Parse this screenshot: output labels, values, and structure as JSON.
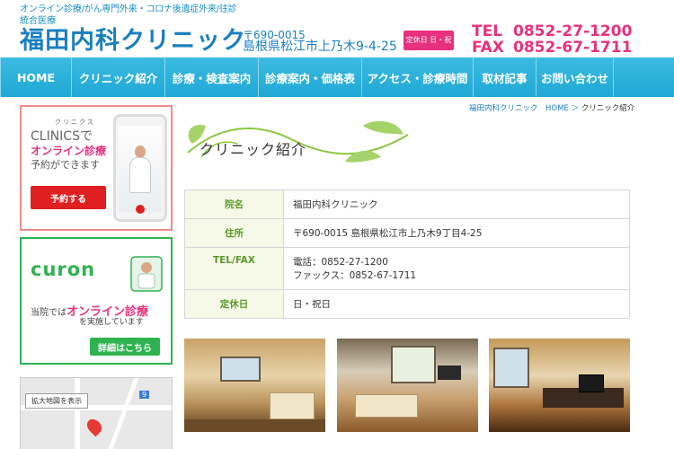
{
  "header": {
    "tagline": "オンライン診療/がん専門外来・コロナ後遺症外来/往診",
    "sub_tag": "統合医療",
    "clinic_name": "福田内科クリニック",
    "postal": "〒690-0015",
    "address": "島根県松江市上乃木9-4-25",
    "holiday_badge": "定休日 日・祝日",
    "tel_label": "TEL",
    "tel": "0852-27-1200",
    "fax_label": "FAX",
    "fax": "0852-67-1711"
  },
  "nav": {
    "items": [
      {
        "label": "HOME"
      },
      {
        "label": "クリニック紹介"
      },
      {
        "label": "診療・検査案内"
      },
      {
        "label": "診療案内・価格表"
      },
      {
        "label": "アクセス・診療時間"
      },
      {
        "label": "取材記事"
      },
      {
        "label": "お問い合わせ"
      }
    ]
  },
  "sidebar": {
    "clinics_small": "クリニクス",
    "clinics_title": "CLINICSで",
    "clinics_pink": "オンライン診療",
    "clinics_avail": "予約ができます",
    "reserve_label": "予約する",
    "curon_logo": "curon",
    "curon_text1_a": "当院では",
    "curon_text1_b": "オンライン診療",
    "curon_text2": "を実施しています",
    "curon_detail_label": "詳細はこちら",
    "map_button_label": "拡大地図を表示",
    "map_road_number": "9"
  },
  "breadcrumb": {
    "home": "福田内科クリニック　HOME",
    "separator": "＞",
    "current": "クリニック紹介"
  },
  "main": {
    "section_title": "クリニック紹介",
    "info_rows": [
      {
        "label": "院名",
        "value": "福田内科クリニック"
      },
      {
        "label": "住所",
        "value": "〒690-0015 島根県松江市上乃木9丁目4-25"
      },
      {
        "label": "TEL/FAX",
        "value": "電話：0852-27-1200",
        "value2": "ファックス：0852-67-1711"
      },
      {
        "label": "定休日",
        "value": "日・祝日"
      }
    ]
  },
  "colors": {
    "brand_blue": "#1a7fc0",
    "nav_blue": "#20a8d6",
    "pink": "#e8317e",
    "green": "#2fb350",
    "table_label_green": "#5a9a2a"
  }
}
